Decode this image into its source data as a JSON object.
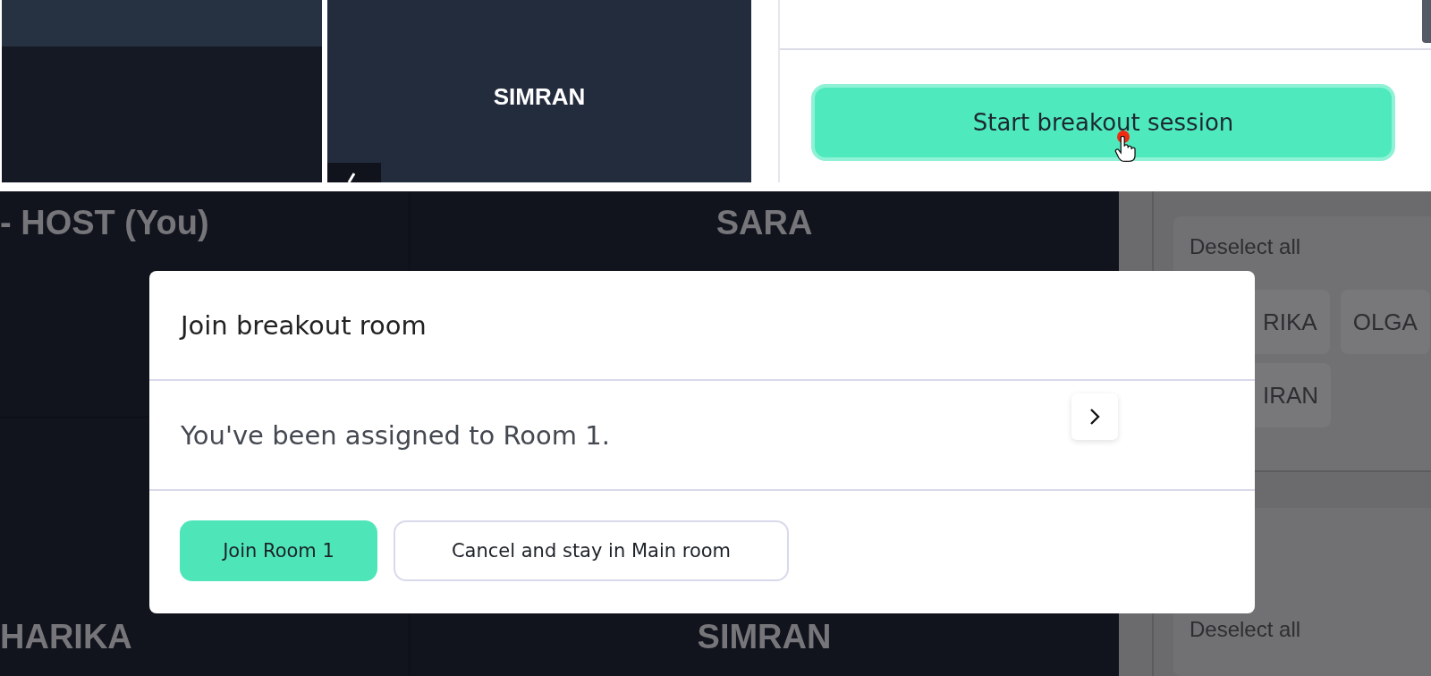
{
  "top": {
    "tiles": [
      {
        "name": "SIMRAN"
      }
    ],
    "start_button": {
      "label": "Start breakout session"
    }
  },
  "bottom": {
    "tiles": [
      {
        "name": "- HOST (You)"
      },
      {
        "name": "SARA"
      },
      {
        "name": "HARIKA"
      },
      {
        "name": "SIMRAN"
      }
    ],
    "panel": {
      "groups": [
        {
          "action": "Deselect all",
          "chips": [
            "RIKA",
            "OLGA",
            "IRAN"
          ]
        },
        {
          "action": "Deselect all"
        }
      ]
    }
  },
  "dialog": {
    "title": "Join breakout room",
    "message": "You've been assigned to Room 1.",
    "buttons": [
      {
        "label": "Join Room 1",
        "kind": "primary"
      },
      {
        "label": "Cancel and stay in Main room",
        "kind": "secondary"
      }
    ]
  }
}
